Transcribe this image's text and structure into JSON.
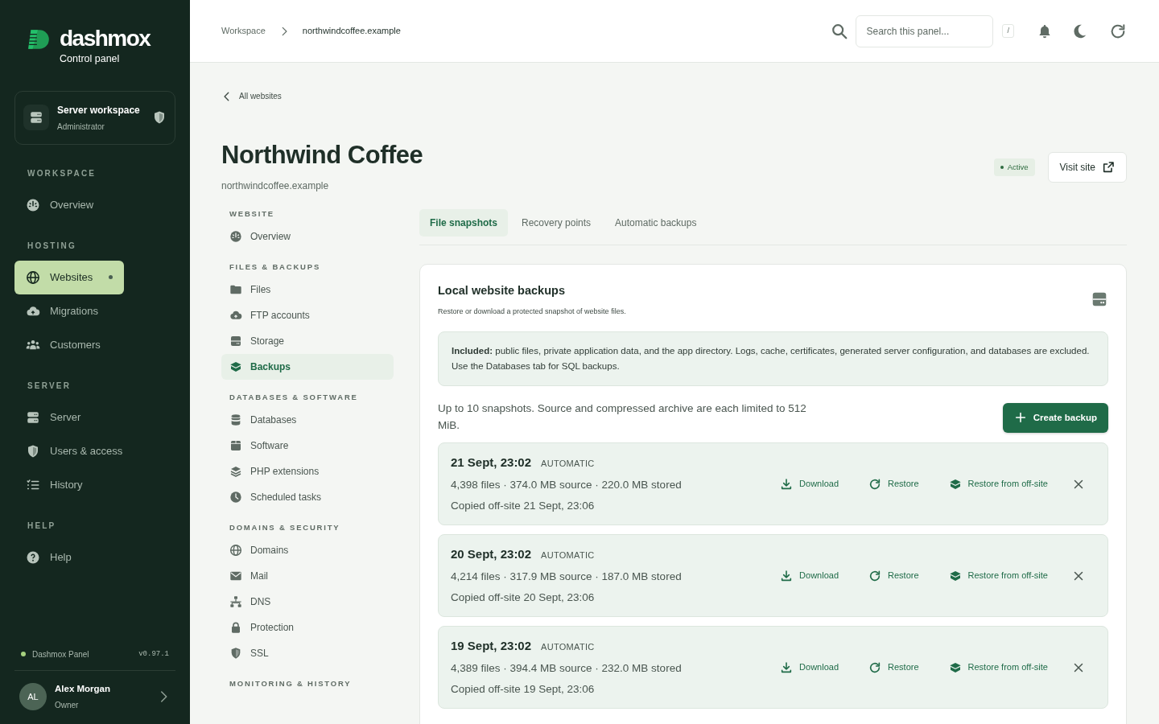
{
  "brand": {
    "name": "dashmox",
    "tagline": "Control panel"
  },
  "workspace_card": {
    "title": "Server workspace",
    "role": "Administrator"
  },
  "sidebar": {
    "sections": [
      {
        "heading": "WORKSPACE",
        "items": [
          {
            "label": "Overview",
            "selected": false,
            "indicator": false
          }
        ]
      },
      {
        "heading": "HOSTING",
        "items": [
          {
            "label": "Websites",
            "selected": true,
            "indicator": true
          },
          {
            "label": "Migrations",
            "selected": false,
            "indicator": false
          },
          {
            "label": "Customers",
            "selected": false,
            "indicator": false
          }
        ]
      },
      {
        "heading": "SERVER",
        "items": [
          {
            "label": "Server",
            "selected": false,
            "indicator": false
          },
          {
            "label": "Users & access",
            "selected": false,
            "indicator": false
          },
          {
            "label": "History",
            "selected": false,
            "indicator": false
          }
        ]
      },
      {
        "heading": "HELP",
        "items": [
          {
            "label": "Help",
            "selected": false,
            "indicator": false
          }
        ]
      }
    ]
  },
  "footer": {
    "app": "Dashmox Panel",
    "version": "v0.97.1"
  },
  "user": {
    "initials": "AL",
    "name": "Alex Morgan",
    "role": "Owner"
  },
  "topbar": {
    "breadcrumbs": [
      {
        "label": "Workspace",
        "current": false
      },
      {
        "label": "northwindcoffee.example",
        "current": true
      }
    ],
    "search": {
      "placeholder": "Search this panel..."
    },
    "shortcut": "/"
  },
  "page": {
    "back_link": "All websites",
    "title": "Northwind Coffee",
    "domain": "northwindcoffee.example",
    "status": "Active",
    "visit_button": "Visit site"
  },
  "website_nav": {
    "sections": [
      {
        "heading": "WEBSITE",
        "items": [
          {
            "label": "Overview",
            "selected": false
          }
        ]
      },
      {
        "heading": "FILES & BACKUPS",
        "items": [
          {
            "label": "Files",
            "selected": false
          },
          {
            "label": "FTP accounts",
            "selected": false
          },
          {
            "label": "Storage",
            "selected": false
          },
          {
            "label": "Backups",
            "selected": true
          }
        ]
      },
      {
        "heading": "DATABASES & SOFTWARE",
        "items": [
          {
            "label": "Databases",
            "selected": false
          },
          {
            "label": "Software",
            "selected": false
          },
          {
            "label": "PHP extensions",
            "selected": false
          },
          {
            "label": "Scheduled tasks",
            "selected": false
          }
        ]
      },
      {
        "heading": "DOMAINS & SECURITY",
        "items": [
          {
            "label": "Domains",
            "selected": false
          },
          {
            "label": "Mail",
            "selected": false
          },
          {
            "label": "DNS",
            "selected": false
          },
          {
            "label": "Protection",
            "selected": false
          },
          {
            "label": "SSL",
            "selected": false
          }
        ]
      },
      {
        "heading": "MONITORING & HISTORY"
      }
    ]
  },
  "tabs": [
    {
      "label": "File snapshots",
      "selected": true
    },
    {
      "label": "Recovery points",
      "selected": false
    },
    {
      "label": "Automatic backups",
      "selected": false
    }
  ],
  "backups_panel": {
    "title": "Local website backups",
    "subtitle": "Restore or download a protected snapshot of website files.",
    "notice": "**Included:** public files, private application data, and the app directory. Logs, cache, certificates, generated server configuration, and databases are excluded. Use the Databases tab for SQL backups.",
    "limit_text": "Up to 10 snapshots. Source and compressed archive are each limited to 512 MiB.",
    "create_button": "Create backup",
    "snapshots": [
      {
        "date": "21 Sept, 23:02",
        "type": "AUTOMATIC",
        "stats": "4,398 files · 374.0 MB source · 220.0 MB stored",
        "offsite": "Copied off-site 21 Sept, 23:06",
        "actions": [
          "Download",
          "Restore",
          "Restore from off-site"
        ]
      },
      {
        "date": "20 Sept, 23:02",
        "type": "AUTOMATIC",
        "stats": "4,214 files · 317.9 MB source · 187.0 MB stored",
        "offsite": "Copied off-site 20 Sept, 23:06",
        "actions": [
          "Download",
          "Restore",
          "Restore from off-site"
        ]
      },
      {
        "date": "19 Sept, 23:02",
        "type": "AUTOMATIC",
        "stats": "4,389 files · 394.4 MB source · 232.0 MB stored",
        "offsite": "Copied off-site 19 Sept, 23:06",
        "actions": [
          "Download",
          "Restore",
          "Restore from off-site"
        ]
      }
    ]
  }
}
